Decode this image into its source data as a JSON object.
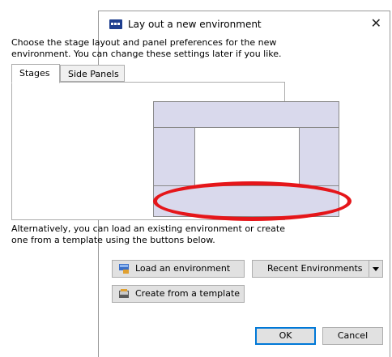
{
  "dialog": {
    "title": "Lay out a new environment",
    "close_glyph": "✕",
    "icon": "app-window-icon",
    "description": "Choose the stage layout and panel preferences for the new environment. You can change these settings later if you like."
  },
  "tabs": [
    {
      "label": "Stages",
      "selected": true
    },
    {
      "label": "Side Panels",
      "selected": false
    }
  ],
  "layout_preview": {
    "stage_color": "#d9d9ec",
    "stages": [
      "top",
      "left",
      "center",
      "right",
      "bottom"
    ]
  },
  "annotation": {
    "ring_color": "#e5161a",
    "arrow_color": "#e5161a"
  },
  "alternative_text": "Alternatively, you can load an existing environment or create one from a template using the buttons below.",
  "buttons": {
    "load": "Load an environment",
    "recent": "Recent Environments",
    "template": "Create from a template",
    "ok": "OK",
    "cancel": "Cancel"
  },
  "icons": {
    "load": "load-environment-icon",
    "template": "template-icon",
    "dropdown": "chevron-down-icon"
  }
}
